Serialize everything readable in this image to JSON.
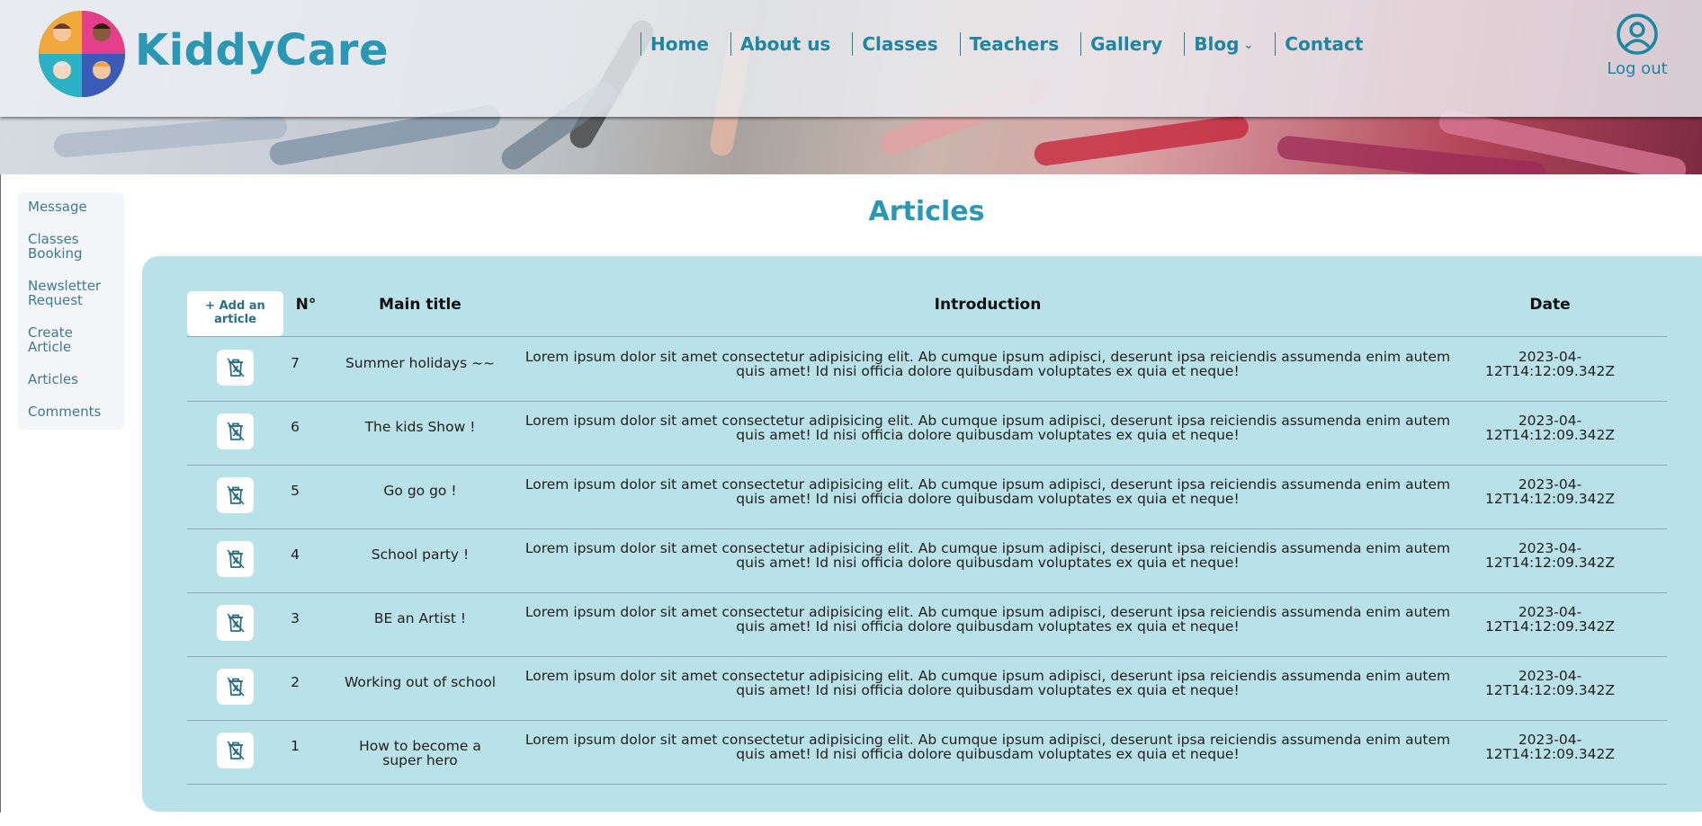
{
  "header": {
    "brand": "KiddyCare",
    "nav": [
      {
        "label": "Home",
        "has_dropdown": false
      },
      {
        "label": "About us",
        "has_dropdown": false
      },
      {
        "label": "Classes",
        "has_dropdown": false
      },
      {
        "label": "Teachers",
        "has_dropdown": false
      },
      {
        "label": "Gallery",
        "has_dropdown": false
      },
      {
        "label": "Blog",
        "has_dropdown": true
      },
      {
        "label": "Contact",
        "has_dropdown": false
      }
    ],
    "logout_label": "Log out",
    "logout_icon": "user-circle-icon"
  },
  "sidebar": {
    "items": [
      {
        "label": "Message"
      },
      {
        "label": "Classes Booking"
      },
      {
        "label": "Newsletter Request"
      },
      {
        "label": "Create Article"
      },
      {
        "label": "Articles"
      },
      {
        "label": "Comments"
      }
    ]
  },
  "main": {
    "title": "Articles",
    "add_button_label": "+ Add an article",
    "columns": [
      "N°",
      "Main title",
      "Introduction",
      "Date"
    ],
    "delete_icon": "trash-cross-icon",
    "rows": [
      {
        "num": "7",
        "title": "Summer holidays ~~",
        "intro": "Lorem ipsum dolor sit amet consectetur adipisicing elit. Ab cumque ipsum adipisci, deserunt ipsa reiciendis assumenda enim autem quis amet! Id nisi officia dolore quibusdam voluptates ex quia et neque!",
        "date": "2023-04-12T14:12:09.342Z"
      },
      {
        "num": "6",
        "title": "The kids Show !",
        "intro": "Lorem ipsum dolor sit amet consectetur adipisicing elit. Ab cumque ipsum adipisci, deserunt ipsa reiciendis assumenda enim autem quis amet! Id nisi officia dolore quibusdam voluptates ex quia et neque!",
        "date": "2023-04-12T14:12:09.342Z"
      },
      {
        "num": "5",
        "title": "Go go go !",
        "intro": "Lorem ipsum dolor sit amet consectetur adipisicing elit. Ab cumque ipsum adipisci, deserunt ipsa reiciendis assumenda enim autem quis amet! Id nisi officia dolore quibusdam voluptates ex quia et neque!",
        "date": "2023-04-12T14:12:09.342Z"
      },
      {
        "num": "4",
        "title": "School party !",
        "intro": "Lorem ipsum dolor sit amet consectetur adipisicing elit. Ab cumque ipsum adipisci, deserunt ipsa reiciendis assumenda enim autem quis amet! Id nisi officia dolore quibusdam voluptates ex quia et neque!",
        "date": "2023-04-12T14:12:09.342Z"
      },
      {
        "num": "3",
        "title": "BE an Artist !",
        "intro": "Lorem ipsum dolor sit amet consectetur adipisicing elit. Ab cumque ipsum adipisci, deserunt ipsa reiciendis assumenda enim autem quis amet! Id nisi officia dolore quibusdam voluptates ex quia et neque!",
        "date": "2023-04-12T14:12:09.342Z"
      },
      {
        "num": "2",
        "title": "Working out of school",
        "intro": "Lorem ipsum dolor sit amet consectetur adipisicing elit. Ab cumque ipsum adipisci, deserunt ipsa reiciendis assumenda enim autem quis amet! Id nisi officia dolore quibusdam voluptates ex quia et neque!",
        "date": "2023-04-12T14:12:09.342Z"
      },
      {
        "num": "1",
        "title": "How to become a super hero",
        "intro": "Lorem ipsum dolor sit amet consectetur adipisicing elit. Ab cumque ipsum adipisci, deserunt ipsa reiciendis assumenda enim autem quis amet! Id nisi officia dolore quibusdam voluptates ex quia et neque!",
        "date": "2023-04-12T14:12:09.342Z"
      }
    ]
  },
  "colors": {
    "accent": "#2a98b4",
    "nav_text": "#1d86a3",
    "panel_bg": "#b9e1e8",
    "sidebar_text": "#3e7b91"
  }
}
